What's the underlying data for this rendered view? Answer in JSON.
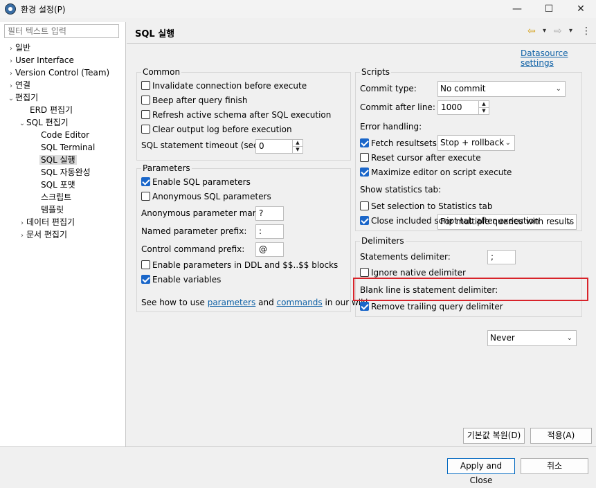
{
  "window": {
    "title": "환경 설정(P)",
    "minimize": "—",
    "maximize": "☐",
    "close": "✕"
  },
  "filter": {
    "placeholder": "필터 텍스트 입력"
  },
  "tree": [
    {
      "label": "일반",
      "arrow": "›"
    },
    {
      "label": "User Interface",
      "arrow": "›"
    },
    {
      "label": "Version Control (Team)",
      "arrow": "›"
    },
    {
      "label": "연결",
      "arrow": "›"
    },
    {
      "label": "편집기",
      "arrow": "⌄"
    },
    {
      "label": "ERD 편집기",
      "arrow": ""
    },
    {
      "label": "SQL 편집기",
      "arrow": "⌄"
    },
    {
      "label": "Code Editor",
      "arrow": ""
    },
    {
      "label": "SQL Terminal",
      "arrow": ""
    },
    {
      "label": "SQL 실행",
      "arrow": ""
    },
    {
      "label": "SQL 자동완성",
      "arrow": ""
    },
    {
      "label": "SQL 포맷",
      "arrow": ""
    },
    {
      "label": "스크립트",
      "arrow": ""
    },
    {
      "label": "템플릿",
      "arrow": ""
    },
    {
      "label": "데이터 편집기",
      "arrow": "›"
    },
    {
      "label": "문서 편집기",
      "arrow": "›"
    }
  ],
  "page": {
    "title": "SQL 실행",
    "datasource_link": "Datasource settings",
    "nav_back": "⇦",
    "nav_forward": "⇨",
    "nav_dropdown": "▾",
    "menu": "⋮"
  },
  "common": {
    "label": "Common",
    "invalidate": "Invalidate connection before execute",
    "beep": "Beep after query finish",
    "refresh": "Refresh active schema after SQL execution",
    "clear_log": "Clear output log before execution",
    "timeout_label": "SQL statement timeout (sec):",
    "timeout_value": "0"
  },
  "parameters": {
    "label": "Parameters",
    "enable_sql": "Enable SQL parameters",
    "anonymous": "Anonymous SQL parameters",
    "anon_mark_label": "Anonymous parameter mark:",
    "anon_mark_value": "?",
    "named_prefix_label": "Named parameter prefix:",
    "named_prefix_value": ":",
    "control_prefix_label": "Control command prefix:",
    "control_prefix_value": "@",
    "ddl": "Enable parameters in DDL and $$..$$ blocks",
    "variables": "Enable variables",
    "wiki_pre": "See how to use ",
    "wiki_parameters": "parameters",
    "wiki_and": " and ",
    "wiki_commands": "commands",
    "wiki_post": " in our wiki"
  },
  "scripts": {
    "label": "Scripts",
    "commit_type_label": "Commit type:",
    "commit_type_value": "No commit",
    "commit_after_label": "Commit after line:",
    "commit_after_value": "1000",
    "error_label": "Error handling:",
    "error_value": "Stop + rollback",
    "fetch": "Fetch resultsets",
    "reset_cursor": "Reset cursor after execute",
    "maximize": "Maximize editor on script execute",
    "stats_label": "Show statistics tab:",
    "stats_value": "For multiple queries with results",
    "set_selection": "Set selection to Statistics tab",
    "close_tab": "Close included script tab after execution"
  },
  "delimiters": {
    "label": "Delimiters",
    "statements_label": "Statements delimiter:",
    "statements_value": ";",
    "ignore_native": "Ignore native delimiter",
    "blank_line_label": "Blank line is statement delimiter:",
    "blank_line_value": "Never",
    "remove_trailing": "Remove trailing query delimiter"
  },
  "buttons": {
    "restore_defaults": "기본값 복원(D)",
    "apply": "적용(A)",
    "apply_close": "Apply and Close",
    "cancel": "취소"
  },
  "colors": {
    "accent": "#1a66c9",
    "highlight": "#d8232a",
    "link": "#0b5fa5"
  }
}
